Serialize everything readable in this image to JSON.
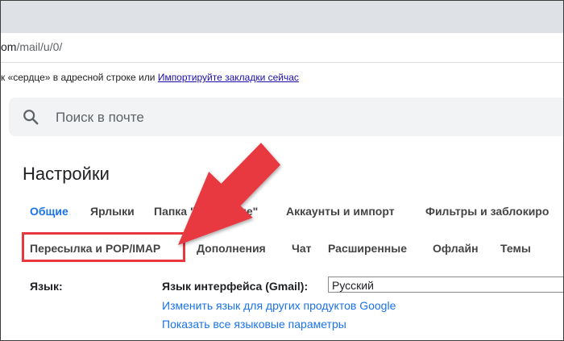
{
  "browser": {
    "url_path": "/mail/u/0/",
    "url_domain_fragment": "om",
    "bookmarks_hint": "к «сердце» в адресной строке или",
    "bookmarks_link": "Импортируйте закладки сейчас"
  },
  "search": {
    "placeholder": "Поиск в почте",
    "icon": "search-icon"
  },
  "settings": {
    "title": "Настройки",
    "tabs_row1": [
      {
        "label": "Общие",
        "active": true
      },
      {
        "label": "Ярлыки",
        "active": false
      },
      {
        "label": "Папка \"Входящие\"",
        "active": false
      },
      {
        "label": "Аккаунты и импорт",
        "active": false
      },
      {
        "label": "Фильтры и заблокиро",
        "active": false
      }
    ],
    "tabs_row2": [
      {
        "label": "Пересылка и POP/IMAP",
        "active": false
      },
      {
        "label": "Дополнения",
        "active": false
      },
      {
        "label": "Чат",
        "active": false
      },
      {
        "label": "Расширенные",
        "active": false
      },
      {
        "label": "Офлайн",
        "active": false
      },
      {
        "label": "Темы",
        "active": false
      }
    ],
    "language": {
      "label": "Язык:",
      "interface_label": "Язык интерфейса (Gmail):",
      "interface_value": "Русский",
      "link_other_products": "Изменить язык для других продуктов Google",
      "link_all_params": "Показать все языковые параметры"
    }
  },
  "annotation": {
    "highlight_color": "#e8373f",
    "arrow_color": "#e8373f"
  },
  "colors": {
    "link": "#1a73e8",
    "text": "#202124",
    "search_bg": "#f1f3f4"
  }
}
